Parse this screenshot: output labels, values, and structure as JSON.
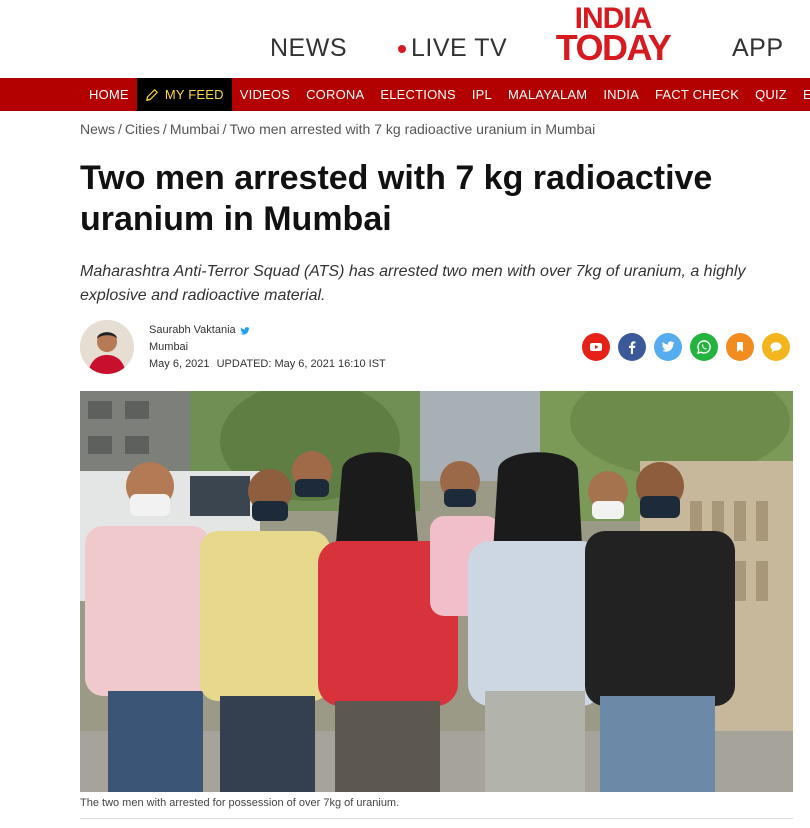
{
  "header": {
    "news_label": "NEWS",
    "live_label": "LIVE TV",
    "logo_line1": "INDIA",
    "logo_line2": "TODAY",
    "app_label": "APP"
  },
  "nav": {
    "items": [
      "HOME",
      "MY FEED",
      "VIDEOS",
      "CORONA",
      "ELECTIONS",
      "IPL",
      "MALAYALAM",
      "INDIA",
      "FACT CHECK",
      "QUIZ",
      "EDU"
    ],
    "active_index": 1
  },
  "breadcrumb": [
    "News",
    "Cities",
    "Mumbai",
    "Two men arrested with 7 kg radioactive uranium in Mumbai"
  ],
  "article": {
    "headline": "Two men arrested with 7 kg radioactive uranium in Mumbai",
    "summary": "Maharashtra Anti-Terror Squad (ATS) has arrested two men with over 7kg of uranium, a highly explosive and radioactive material.",
    "author": "Saurabh Vaktania",
    "location": "Mumbai",
    "published": "May 6, 2021",
    "updated_label": "UPDATED: May 6, 2021 16:10 IST",
    "caption": "The two men with arrested for possession of over 7kg of uranium."
  },
  "share": [
    {
      "icon": "youtube-icon",
      "color": "#e62117"
    },
    {
      "icon": "facebook-icon",
      "color": "#3b5998"
    },
    {
      "icon": "twitter-icon",
      "color": "#55acee"
    },
    {
      "icon": "whatsapp-icon",
      "color": "#25b33f"
    },
    {
      "icon": "bookmark-icon",
      "color": "#f28c1e"
    },
    {
      "icon": "comment-icon",
      "color": "#f2b51e"
    }
  ],
  "colors": {
    "brand_red": "#d71920",
    "nav_red": "#b30000",
    "active_text": "#ffd83a"
  }
}
